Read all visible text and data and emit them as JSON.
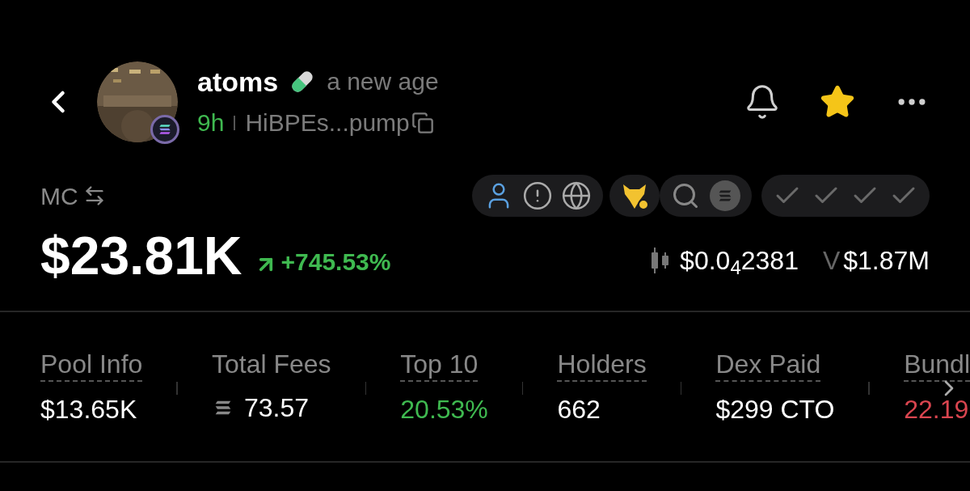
{
  "token": {
    "name": "atoms",
    "tagline": "a new age",
    "age": "9h",
    "address": "HiBPEs...pump"
  },
  "header": {
    "starred": true
  },
  "market_cap": {
    "label": "MC",
    "value": "$23.81K",
    "change": "+745.53%"
  },
  "price": "$0.0$_{4}$2381",
  "volume": {
    "label": "V",
    "value": "$1.87M"
  },
  "checks": [
    {
      "checked": true
    },
    {
      "checked": true
    },
    {
      "checked": true
    },
    {
      "checked": true
    }
  ],
  "stats": [
    {
      "label": "Pool Info",
      "value": "$13.65K",
      "color": "#ffffff",
      "underlined": true,
      "kind": "plain"
    },
    {
      "label": "Total Fees",
      "value": "73.57",
      "color": "#ffffff",
      "underlined": false,
      "kind": "sol"
    },
    {
      "label": "Top 10",
      "value": "20.53%",
      "color": "#3fb950",
      "underlined": true,
      "kind": "plain"
    },
    {
      "label": "Holders",
      "value": "662",
      "color": "#ffffff",
      "underlined": true,
      "kind": "plain"
    },
    {
      "label": "Dex Paid",
      "value": "$299 CTO",
      "color": "#ffffff",
      "underlined": true,
      "kind": "plain"
    },
    {
      "label": "Bundl",
      "value": "22.19",
      "color": "#d9454f",
      "underlined": true,
      "kind": "plain"
    }
  ]
}
